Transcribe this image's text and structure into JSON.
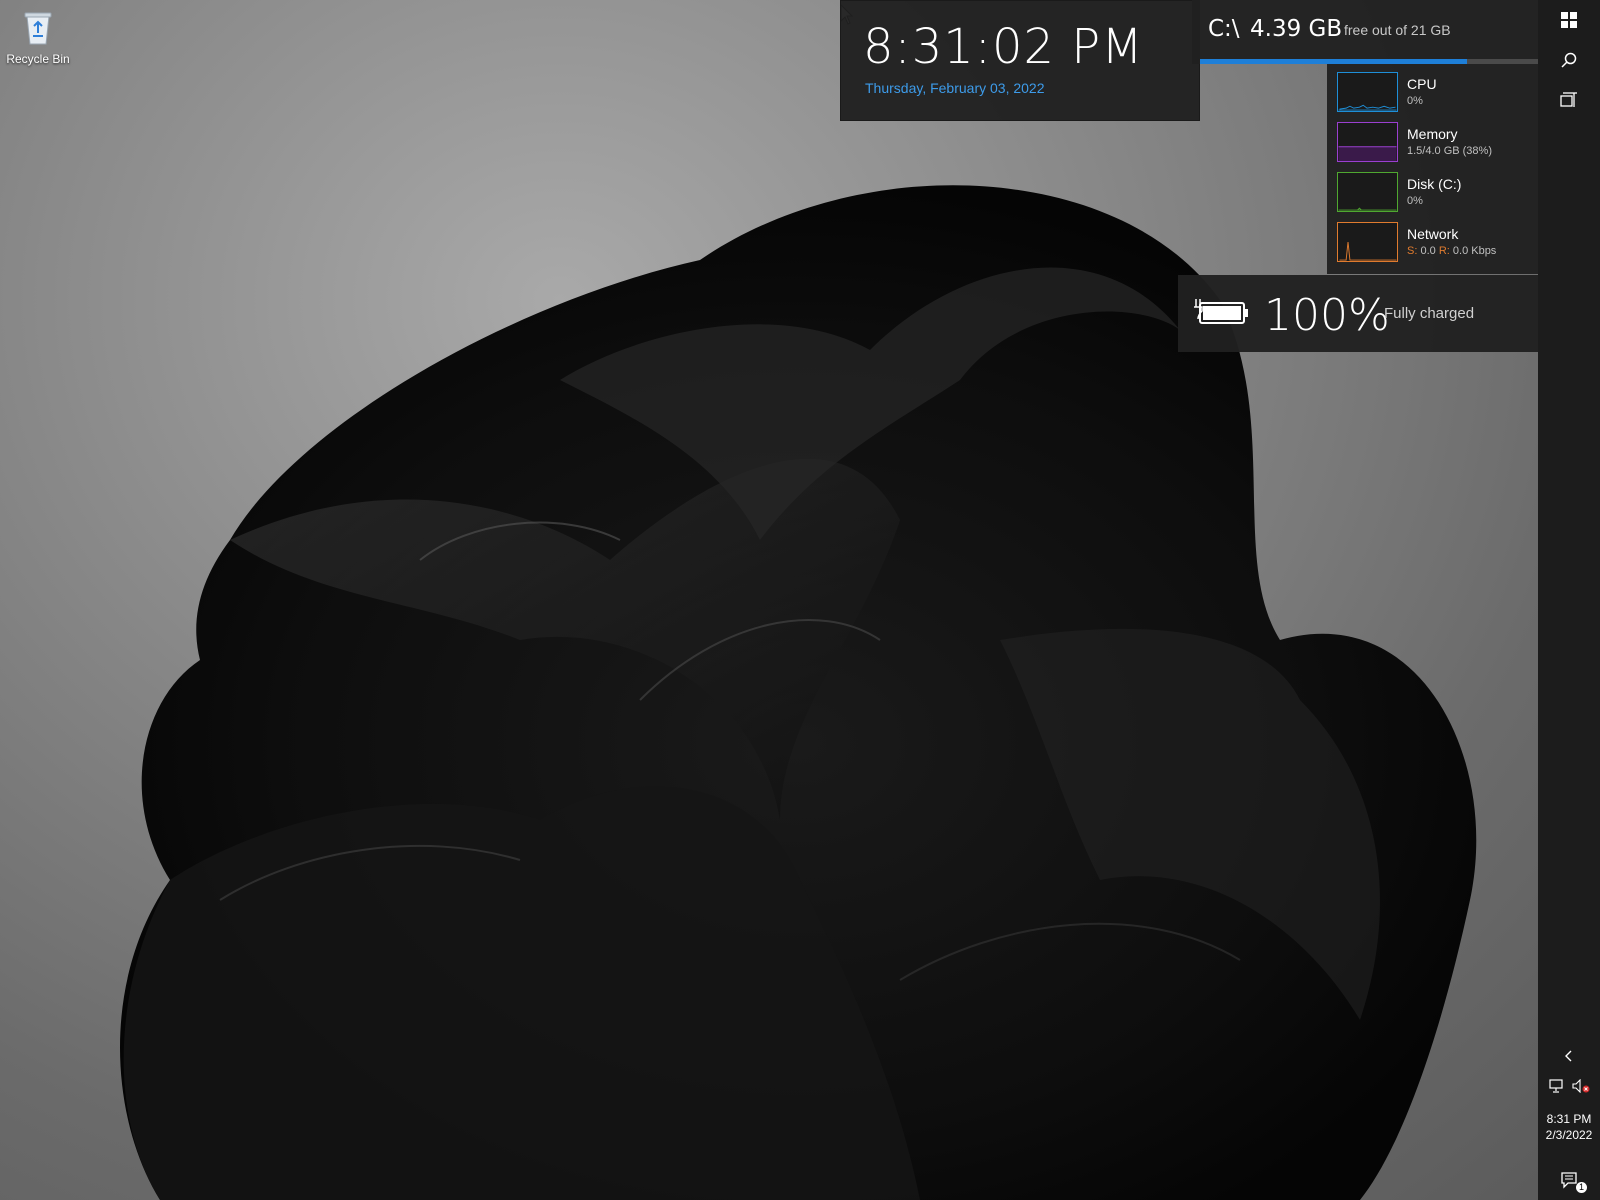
{
  "desktop": {
    "icons": [
      {
        "label": "Recycle Bin",
        "icon": "recycle-bin-icon"
      }
    ]
  },
  "clock_widget": {
    "time": "8:31:02 PM",
    "date": "Thursday, February 03, 2022"
  },
  "disk_widget": {
    "drive": "C:\\",
    "free": "4.39 GB",
    "label": "free out of 21 GB",
    "used_fraction": 0.79
  },
  "perf_widget": {
    "cpu": {
      "name": "CPU",
      "value": "0%",
      "color": "#1e8fd8"
    },
    "memory": {
      "name": "Memory",
      "value": "1.5/4.0 GB (38%)",
      "color": "#9a3fd0"
    },
    "disk": {
      "name": "Disk (C:)",
      "value": "0%",
      "color": "#4fa830"
    },
    "network": {
      "name": "Network",
      "s_label": "S:",
      "s_value": "0.0",
      "r_label": "R:",
      "r_value": "0.0 Kbps",
      "color": "#e07b2e"
    }
  },
  "battery_widget": {
    "percent": "100%",
    "status": "Fully charged",
    "icon": "battery-charging-icon"
  },
  "taskbar": {
    "start_icon": "windows-start-icon",
    "search_icon": "search-icon",
    "task_view_icon": "task-view-icon",
    "tray_chevron_icon": "chevron-left-icon",
    "network_icon": "network-icon",
    "volume_icon": "volume-muted-icon",
    "time": "8:31 PM",
    "date": "2/3/2022",
    "notification_icon": "action-center-icon",
    "notification_count": "1"
  }
}
